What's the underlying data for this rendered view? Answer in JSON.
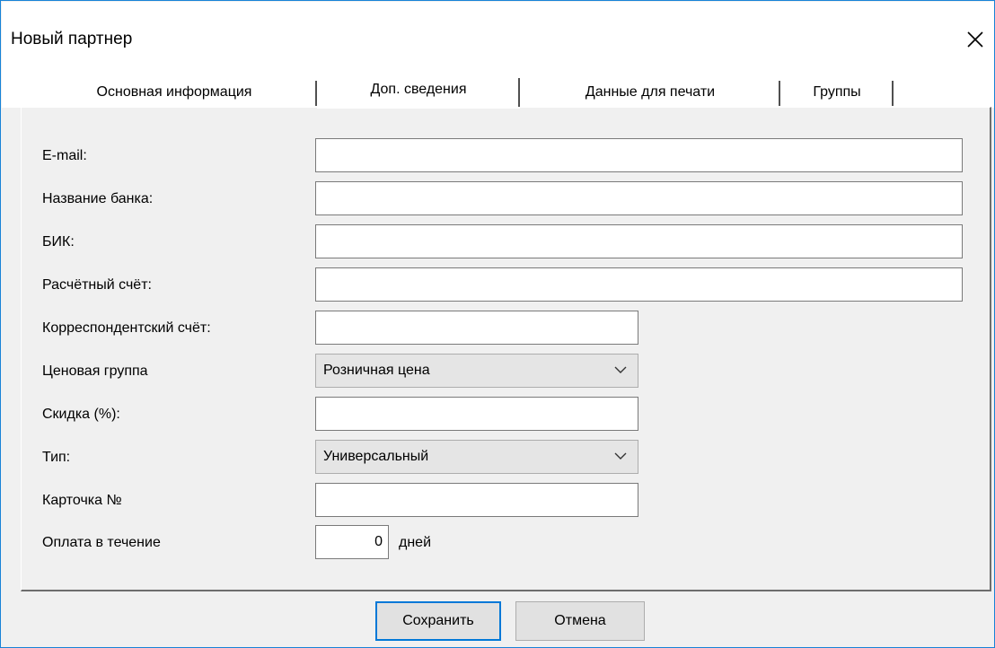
{
  "window": {
    "title": "Новый партнер"
  },
  "tabs": [
    {
      "label": "Основная информация",
      "active": false
    },
    {
      "label": "Доп. сведения",
      "active": true
    },
    {
      "label": "Данные для печати",
      "active": false
    },
    {
      "label": "Группы",
      "active": false
    }
  ],
  "form": {
    "email": {
      "label": "E-mail:",
      "value": ""
    },
    "bank_name": {
      "label": "Название банка:",
      "value": ""
    },
    "bik": {
      "label": "БИК:",
      "value": ""
    },
    "settlement_account": {
      "label": "Расчётный счёт:",
      "value": ""
    },
    "correspondent_account": {
      "label": "Корреспондентский счёт:",
      "value": ""
    },
    "price_group": {
      "label": "Ценовая группа",
      "selected": "Розничная цена"
    },
    "discount": {
      "label": "Скидка (%):",
      "value": ""
    },
    "type": {
      "label": "Тип:",
      "selected": "Универсальный"
    },
    "card_number": {
      "label": "Карточка №",
      "value": ""
    },
    "payment_term": {
      "label": "Оплата в течение",
      "value": "0",
      "unit": "дней"
    }
  },
  "buttons": {
    "save": "Сохранить",
    "cancel": "Отмена"
  },
  "icons": {
    "close": "close-icon",
    "dropdown": "chevron-down-icon"
  }
}
